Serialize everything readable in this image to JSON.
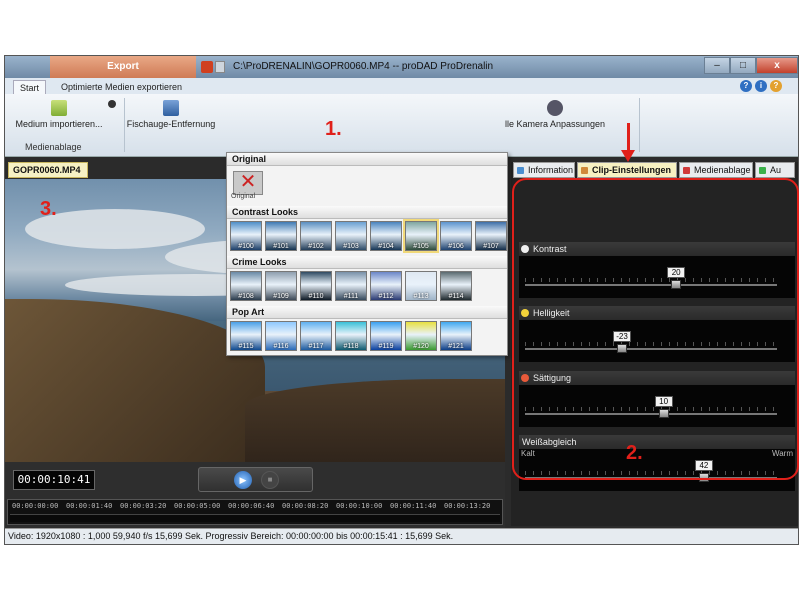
{
  "titlebar": {
    "export_tab": "Export",
    "title": "C:\\ProDRENALIN\\GOPR0060.MP4 -- proDAD ProDrenalin",
    "minimize": "–",
    "maximize": "□",
    "close": "x"
  },
  "ribbon_tabs": {
    "start": "Start",
    "optimized": "Optimierte Medien exportieren",
    "help1": "?",
    "help2": "i",
    "help3": "?"
  },
  "ribbon": {
    "import_label": "Medium importieren...",
    "fisheye_label": "Fischauge-Entfernung",
    "camera_label": "lle Kamera Anpassungen",
    "group_label": "Medienablage"
  },
  "clip_tab": "GOPR0060.MP4",
  "player": {
    "timecode": "00:00:10:41",
    "play": "▶",
    "stop": "■",
    "timeline_ticks": [
      "00:00:00:00",
      "00:00:01:40",
      "00:00:03:20",
      "00:00:05:00",
      "00:00:06:40",
      "00:00:08:20",
      "00:00:10:00",
      "00:00:11:40",
      "00:00:13:20"
    ]
  },
  "status": "Video: 1920x1080 : 1,000   59,940 f/s   15,699 Sek.   Progressiv   Bereich: 00:00:00:00 bis 00:00:15:41 : 15,699 Sek.",
  "panel_tabs": [
    {
      "label": "Information",
      "color": "#4a8ed0"
    },
    {
      "label": "Clip-Einstellungen",
      "color": "#d08a3a"
    },
    {
      "label": "Medienablage",
      "color": "#d03a3a"
    },
    {
      "label": "Au",
      "color": "#3ab04a"
    }
  ],
  "sliders": [
    {
      "label": "Kontrast",
      "value": "20",
      "fraction": 0.6,
      "dot": "#f0f0f0"
    },
    {
      "label": "Helligkeit",
      "value": "-23",
      "fraction": 0.385,
      "dot": "#f2d23a"
    },
    {
      "label": "Sättigung",
      "value": "10",
      "fraction": 0.55,
      "dot": "#e85a3a"
    },
    {
      "label": "Weißabgleich",
      "value": "42",
      "fraction": 0.71,
      "dot": ""
    }
  ],
  "wb": {
    "kalt": "Kalt",
    "warm": "Warm"
  },
  "looks": {
    "original_head": "Original",
    "original_label": "Original",
    "contrast_head": "Contrast Looks",
    "crime_head": "Crime Looks",
    "pop_head": "Pop Art",
    "contrast": [
      {
        "id": "#100",
        "c1": "#4f8fc8",
        "c2": "#1c3f6a"
      },
      {
        "id": "#101",
        "c1": "#3f7ab3",
        "c2": "#14324f"
      },
      {
        "id": "#102",
        "c1": "#5a8ec0",
        "c2": "#223c58"
      },
      {
        "id": "#103",
        "c1": "#6aa0d2",
        "c2": "#2c4a68"
      },
      {
        "id": "#104",
        "c1": "#4a84be",
        "c2": "#163656"
      },
      {
        "id": "#105",
        "c1": "#7fa6a0",
        "c2": "#2f4d3c"
      },
      {
        "id": "#106",
        "c1": "#5c94cf",
        "c2": "#1e4270"
      },
      {
        "id": "#107",
        "c1": "#3e6fa8",
        "c2": "#122c48"
      }
    ],
    "crime": [
      {
        "id": "#108",
        "c1": "#6a8aa6",
        "c2": "#2a3b4c"
      },
      {
        "id": "#109",
        "c1": "#8e9eae",
        "c2": "#3c4856"
      },
      {
        "id": "#110",
        "c1": "#2f4a62",
        "c2": "#0e1a26"
      },
      {
        "id": "#111",
        "c1": "#7890a8",
        "c2": "#35485c"
      },
      {
        "id": "#112",
        "c1": "#6b86c8",
        "c2": "#2a3a74"
      },
      {
        "id": "#113",
        "c1": "#dfe8f2",
        "c2": "#9fb4c8"
      },
      {
        "id": "#114",
        "c1": "#5a6a70",
        "c2": "#1f2a2e"
      }
    ],
    "pop": [
      {
        "id": "#115",
        "c1": "#4aa0e8",
        "c2": "#104a90"
      },
      {
        "id": "#116",
        "c1": "#8ec8ff",
        "c2": "#2a6ab8"
      },
      {
        "id": "#117",
        "c1": "#5fb0f0",
        "c2": "#1c5aa0"
      },
      {
        "id": "#118",
        "c1": "#3ac0d8",
        "c2": "#0e5a70"
      },
      {
        "id": "#119",
        "c1": "#3aa0f0",
        "c2": "#0a40a0"
      },
      {
        "id": "#120",
        "c1": "#e8e040",
        "c2": "#3a9a30"
      },
      {
        "id": "#121",
        "c1": "#40a8f0",
        "c2": "#0c3e88"
      }
    ]
  },
  "annotations": {
    "one": "1.",
    "two": "2.",
    "three": "3."
  }
}
